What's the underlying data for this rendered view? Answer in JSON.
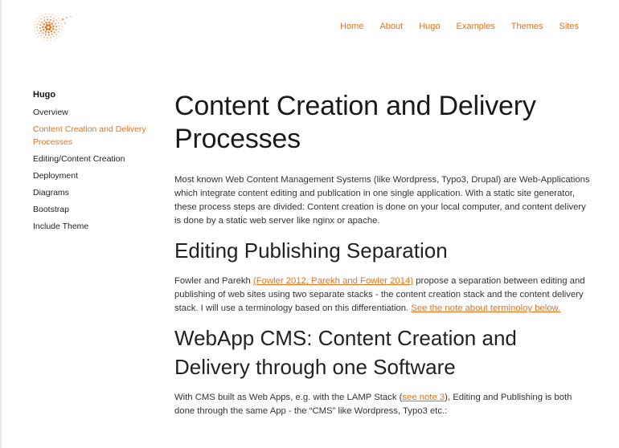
{
  "nav": {
    "items": [
      "Home",
      "About",
      "Hugo",
      "Examples",
      "Themes",
      "Sites"
    ]
  },
  "sidebar": {
    "title": "Hugo",
    "items": [
      {
        "label": "Overview",
        "active": false
      },
      {
        "label": "Content Creation and Delivery Processes",
        "active": true
      },
      {
        "label": "Editing/Content Creation",
        "active": false
      },
      {
        "label": "Deployment",
        "active": false
      },
      {
        "label": "Diagrams",
        "active": false
      },
      {
        "label": "Bootstrap",
        "active": false
      },
      {
        "label": "Include Theme",
        "active": false
      }
    ]
  },
  "main": {
    "title": "Content Creation and Delivery Processes",
    "intro": "Most known Web Content Management Systems (like Wordpress, Typo3, Drupal) are Web-Applications which integrate content editing and publication in one single application. With a static site generator, these process steps are divided: Content creation is done on your local computer, and content delivery is done by a static web server like nginx or apache.",
    "section1": {
      "heading": "Editing Publishing Separation",
      "text_a": "Fowler and Parekh ",
      "link_a": "(Fowler 2012, Parekh and Fowler 2014)",
      "text_b": " propose a separation between editing and publishing of web sites using two separate stacks - the content creation stack and the content delivery stack. I will use a terminology based on this differentiation. ",
      "link_b": "See the note about terminoloy below."
    },
    "section2": {
      "heading": "WebApp CMS: Content Creation and Delivery through one Software",
      "text_a": "With CMS built as Web Apps, e.g. with the LAMP Stack (",
      "link_a": "see note 3",
      "text_b": "), Editing and Publishing is both done through the same App - the “CMS” like Wordpress, Typo3 etc.:"
    }
  },
  "colors": {
    "accent": "#e8701a",
    "text": "#333333",
    "heading": "#1a1a1a"
  },
  "icons": {
    "logo": "orange-dotted-swirl-logo"
  }
}
